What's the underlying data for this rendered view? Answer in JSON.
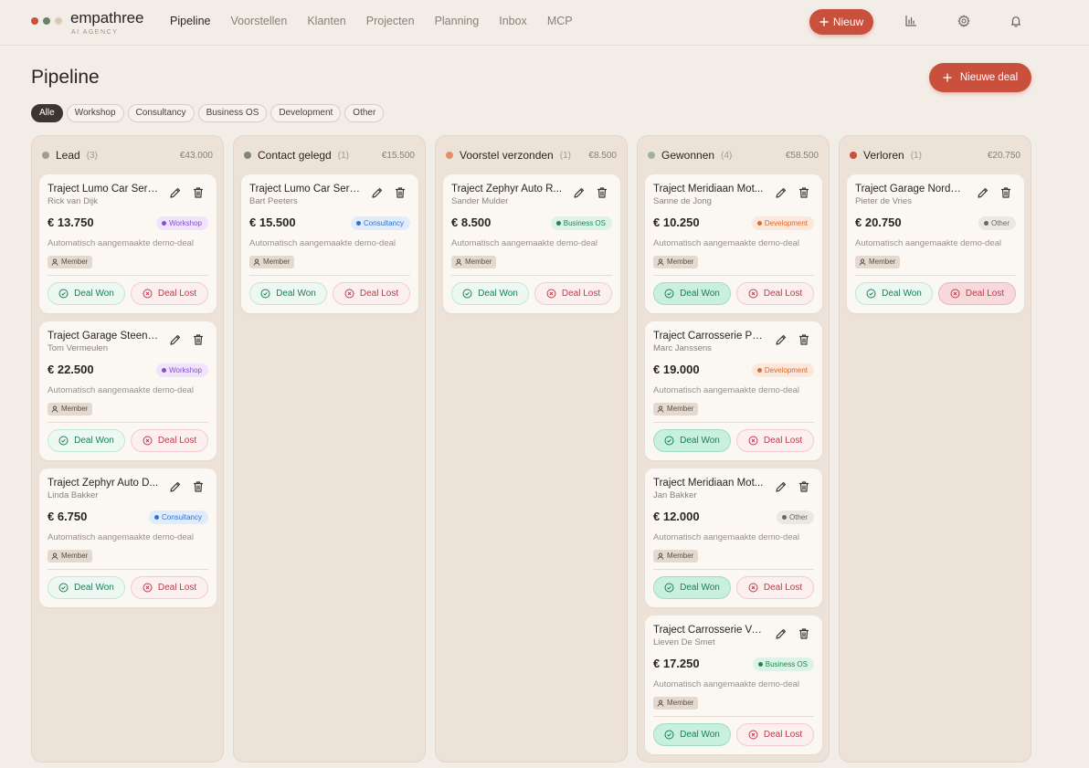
{
  "app": {
    "brand": "empathree",
    "brand_sub": "AI AGENCY",
    "dot_colors": [
      "#c8503d",
      "#6b7f6a",
      "#ddc8b4"
    ]
  },
  "nav": {
    "items": [
      {
        "label": "Pipeline",
        "active": true
      },
      {
        "label": "Voorstellen",
        "active": false
      },
      {
        "label": "Klanten",
        "active": false
      },
      {
        "label": "Projecten",
        "active": false
      },
      {
        "label": "Planning",
        "active": false
      },
      {
        "label": "Inbox",
        "active": false
      },
      {
        "label": "MCP",
        "active": false
      }
    ],
    "new_label": "Nieuw",
    "icons": [
      "chart-icon",
      "gear-icon",
      "bell-icon"
    ]
  },
  "page": {
    "title": "Pipeline",
    "new_deal_label": "Nieuwe deal"
  },
  "filters": [
    {
      "label": "Alle",
      "active": true
    },
    {
      "label": "Workshop",
      "active": false
    },
    {
      "label": "Consultancy",
      "active": false
    },
    {
      "label": "Business OS",
      "active": false
    },
    {
      "label": "Development",
      "active": false
    },
    {
      "label": "Other",
      "active": false
    }
  ],
  "tag_styles": {
    "Workshop": {
      "bg": "#efe4fb",
      "fg": "#8b4bd6"
    },
    "Consultancy": {
      "bg": "#e0ecfb",
      "fg": "#2f73d0"
    },
    "Business OS": {
      "bg": "#dcf3e5",
      "fg": "#1c8a4f"
    },
    "Development": {
      "bg": "#fbe7dc",
      "fg": "#e06a2d"
    },
    "Other": {
      "bg": "#ebe7e3",
      "fg": "#6e6660"
    }
  },
  "labels": {
    "won": "Deal Won",
    "lost": "Deal Lost",
    "role": "Member",
    "desc": "Automatisch aangemaakte demo-deal"
  },
  "columns": [
    {
      "name": "Lead",
      "count": "(3)",
      "total": "€43.000",
      "color": "#a39a92",
      "cards": [
        {
          "title": "Traject Lumo Car Servi...",
          "contact": "Rick van Dijk",
          "amount": "€ 13.750",
          "tag": "Workshop"
        },
        {
          "title": "Traject Garage Steenb...",
          "contact": "Tom Vermeulen",
          "amount": "€ 22.500",
          "tag": "Workshop"
        },
        {
          "title": "Traject Zephyr Auto D...",
          "contact": "Linda Bakker",
          "amount": "€ 6.750",
          "tag": "Consultancy"
        }
      ]
    },
    {
      "name": "Contact gelegd",
      "count": "(1)",
      "total": "€15.500",
      "color": "#7c8a73",
      "cards": [
        {
          "title": "Traject Lumo Car Servi...",
          "contact": "Bart Peeters",
          "amount": "€ 15.500",
          "tag": "Consultancy"
        }
      ]
    },
    {
      "name": "Voorstel verzonden",
      "count": "(1)",
      "total": "€8.500",
      "color": "#e0906a",
      "cards": [
        {
          "title": "Traject Zephyr Auto R...",
          "contact": "Sander Mulder",
          "amount": "€ 8.500",
          "tag": "Business OS"
        }
      ]
    },
    {
      "name": "Gewonnen",
      "count": "(4)",
      "total": "€58.500",
      "color": "#9fb39a",
      "solid_won": true,
      "cards": [
        {
          "title": "Traject Meridiaan Mot...",
          "contact": "Sanne de Jong",
          "amount": "€ 10.250",
          "tag": "Development"
        },
        {
          "title": "Traject Carrosserie Pe...",
          "contact": "Marc Janssens",
          "amount": "€ 19.000",
          "tag": "Development"
        },
        {
          "title": "Traject Meridiaan Mot...",
          "contact": "Jan Bakker",
          "amount": "€ 12.000",
          "tag": "Other"
        },
        {
          "title": "Traject Carrosserie Va...",
          "contact": "Lieven De Smet",
          "amount": "€ 17.250",
          "tag": "Business OS"
        }
      ]
    },
    {
      "name": "Verloren",
      "count": "(1)",
      "total": "€20.750",
      "color": "#c8503d",
      "solid_lost": true,
      "cards": [
        {
          "title": "Traject Garage Nordwi...",
          "contact": "Pieter de Vries",
          "amount": "€ 20.750",
          "tag": "Other"
        }
      ]
    }
  ]
}
